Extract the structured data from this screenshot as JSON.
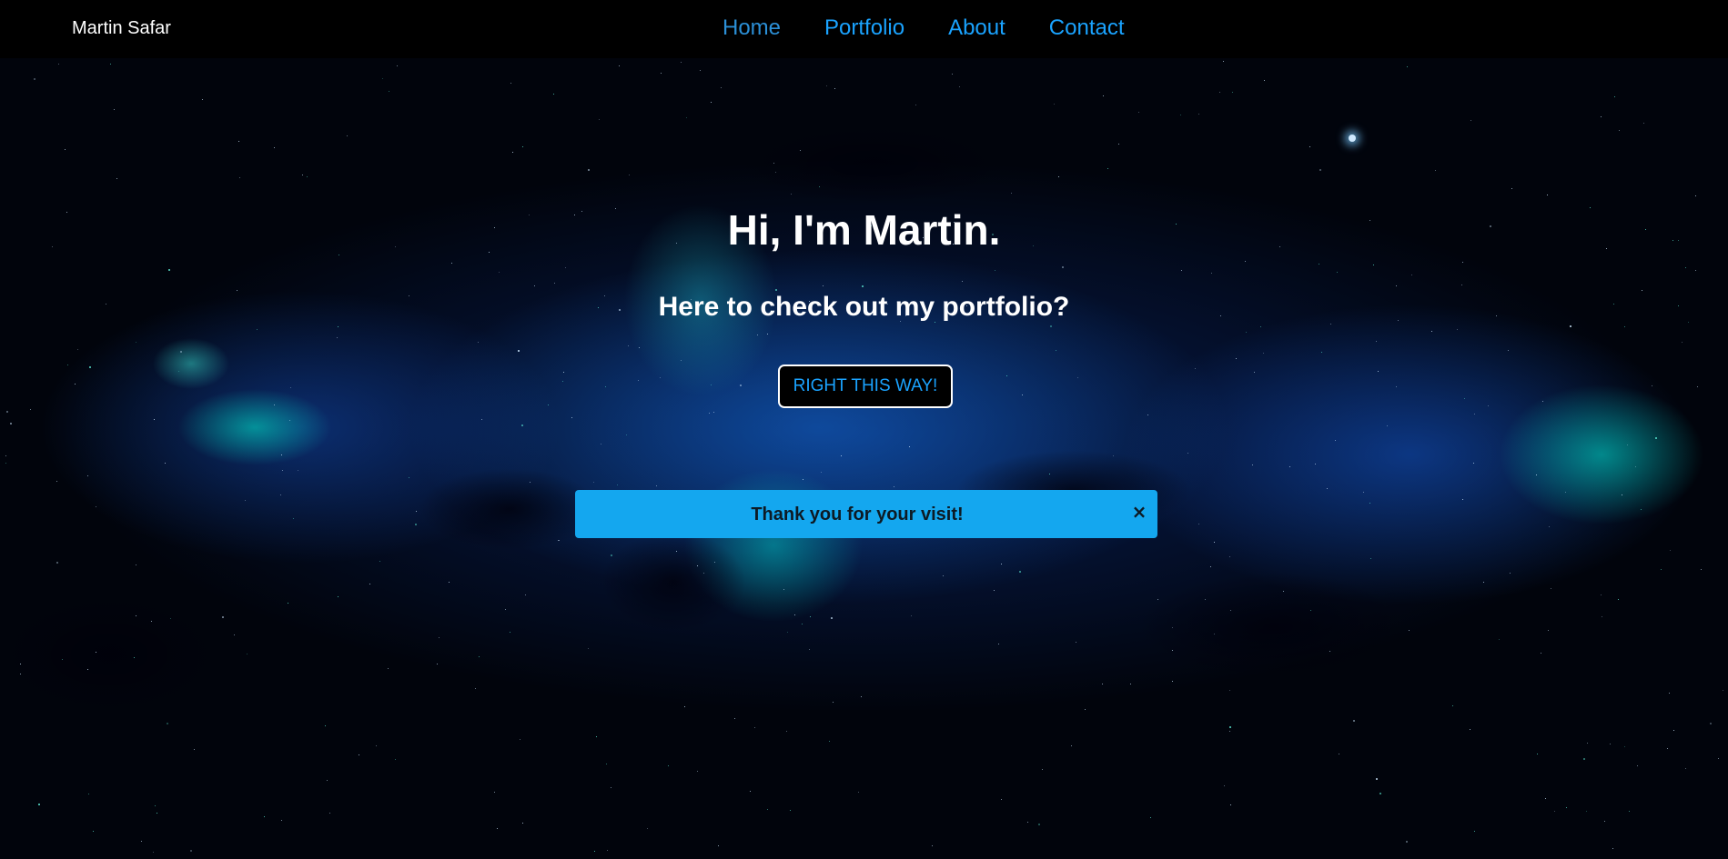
{
  "navbar": {
    "brand": "Martin Safar",
    "links": [
      {
        "label": "Home",
        "active": true
      },
      {
        "label": "Portfolio",
        "active": false
      },
      {
        "label": "About",
        "active": false
      },
      {
        "label": "Contact",
        "active": false
      }
    ]
  },
  "hero": {
    "title": "Hi, I'm Martin.",
    "subtitle": "Here to check out my portfolio?",
    "cta_label": "RIGHT THIS WAY!"
  },
  "alert": {
    "message": "Thank you for your visit!",
    "close_icon": "×"
  },
  "colors": {
    "accent": "#1aa3ff",
    "alert_background": "#14a7ef",
    "nav_background": "#000000"
  },
  "background": {
    "icon": "galaxy-nebula-background"
  }
}
